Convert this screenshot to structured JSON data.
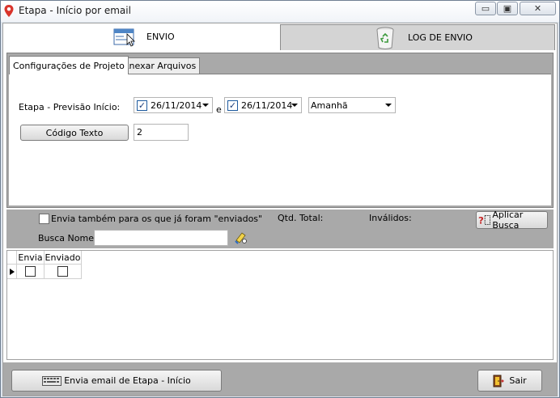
{
  "window": {
    "title": "Etapa - Início por email",
    "minimize_glyph": "▭",
    "maximize_glyph": "▣",
    "close_glyph": "✕"
  },
  "top_tabs": [
    {
      "label": "ENVIO",
      "icon": "window-cursor-icon",
      "active": true
    },
    {
      "label": "LOG DE ENVIO",
      "icon": "recycle-bin-icon",
      "active": false
    }
  ],
  "sub_tabs": [
    {
      "label": "Configurações de Projeto",
      "active": true
    },
    {
      "label": "Anexar Arquivos",
      "active": false
    }
  ],
  "config": {
    "stage_label": "Etapa - Previsão Início:",
    "date_from": "26/11/2014",
    "between_label": "e",
    "date_to": "26/11/2014",
    "period_value": "Amanhã",
    "code_button": "Código Texto",
    "code_value": "2"
  },
  "filter": {
    "send_also_label": "Envia também para os que já foram \"enviados\"",
    "qtd_total_label": "Qtd. Total:",
    "invalidos_label": "Inválidos:",
    "search_name_label": "Busca Nome:",
    "search_name_value": "",
    "apply_button": "Aplicar Busca"
  },
  "grid": {
    "columns": [
      "Envia",
      "Enviado"
    ]
  },
  "footer": {
    "send_button": "Envia email de Etapa - Início",
    "exit_button": "Sair"
  },
  "colors": {
    "panel_gray": "#a9a9a9",
    "checkbox_blue": "#1d5a9e"
  }
}
